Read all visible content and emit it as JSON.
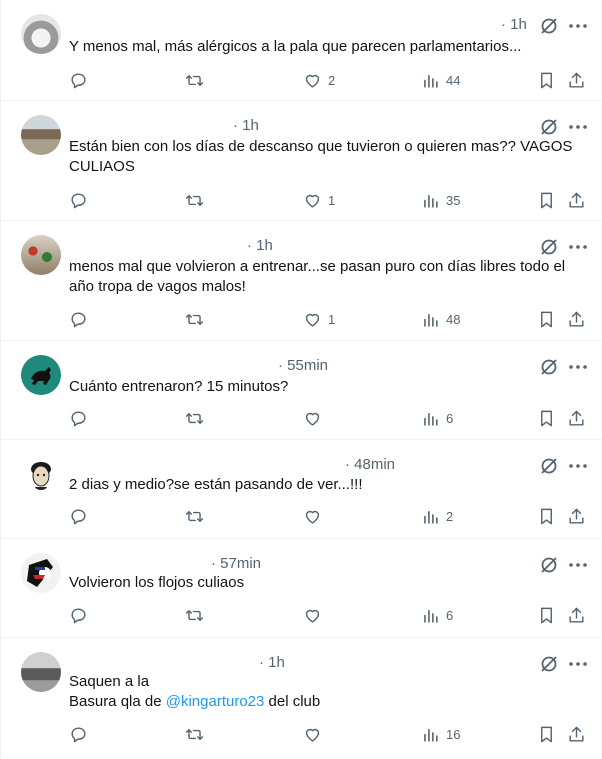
{
  "posts": [
    {
      "time": "· 1h",
      "text": "Y menos mal, más alérgicos a la pala que parecen parlamentarios...",
      "mention": "",
      "text_after": "",
      "likes": "2",
      "views": "44"
    },
    {
      "time": "· 1h",
      "text": "Están bien con los días de descanso que tuvieron o quieren mas?? VAGOS CULIAOS",
      "mention": "",
      "text_after": "",
      "likes": "1",
      "views": "35"
    },
    {
      "time": "· 1h",
      "text": "menos mal que volvieron a entrenar...se pasan puro con días libres todo el año tropa de vagos malos!",
      "mention": "",
      "text_after": "",
      "likes": "1",
      "views": "48"
    },
    {
      "time": "· 55min",
      "text": "Cuánto entrenaron? 15 minutos?",
      "mention": "",
      "text_after": "",
      "likes": "",
      "views": "6"
    },
    {
      "time": "· 48min",
      "text": "2 dias y medio?se están pasando de ver...!!!",
      "mention": "",
      "text_after": "",
      "likes": "",
      "views": "2"
    },
    {
      "time": "· 57min",
      "text": "Volvieron los flojos culiaos",
      "mention": "",
      "text_after": "",
      "likes": "",
      "views": "6"
    },
    {
      "time": "· 1h",
      "text": "Saquen a la\nBasura qla de ",
      "mention": "@kingarturo23",
      "text_after": " del club",
      "likes": "",
      "views": "16"
    }
  ],
  "icons": {
    "reply": "reply-icon",
    "retweet": "retweet-icon",
    "like": "heart-icon",
    "views": "views-icon",
    "bookmark": "bookmark-icon",
    "share": "share-icon",
    "grok": "grok-icon",
    "more": "more-icon"
  },
  "colors": {
    "text": "#0f1419",
    "muted": "#536471",
    "mention": "#1d9bf0",
    "divider": "#eff3f4"
  }
}
